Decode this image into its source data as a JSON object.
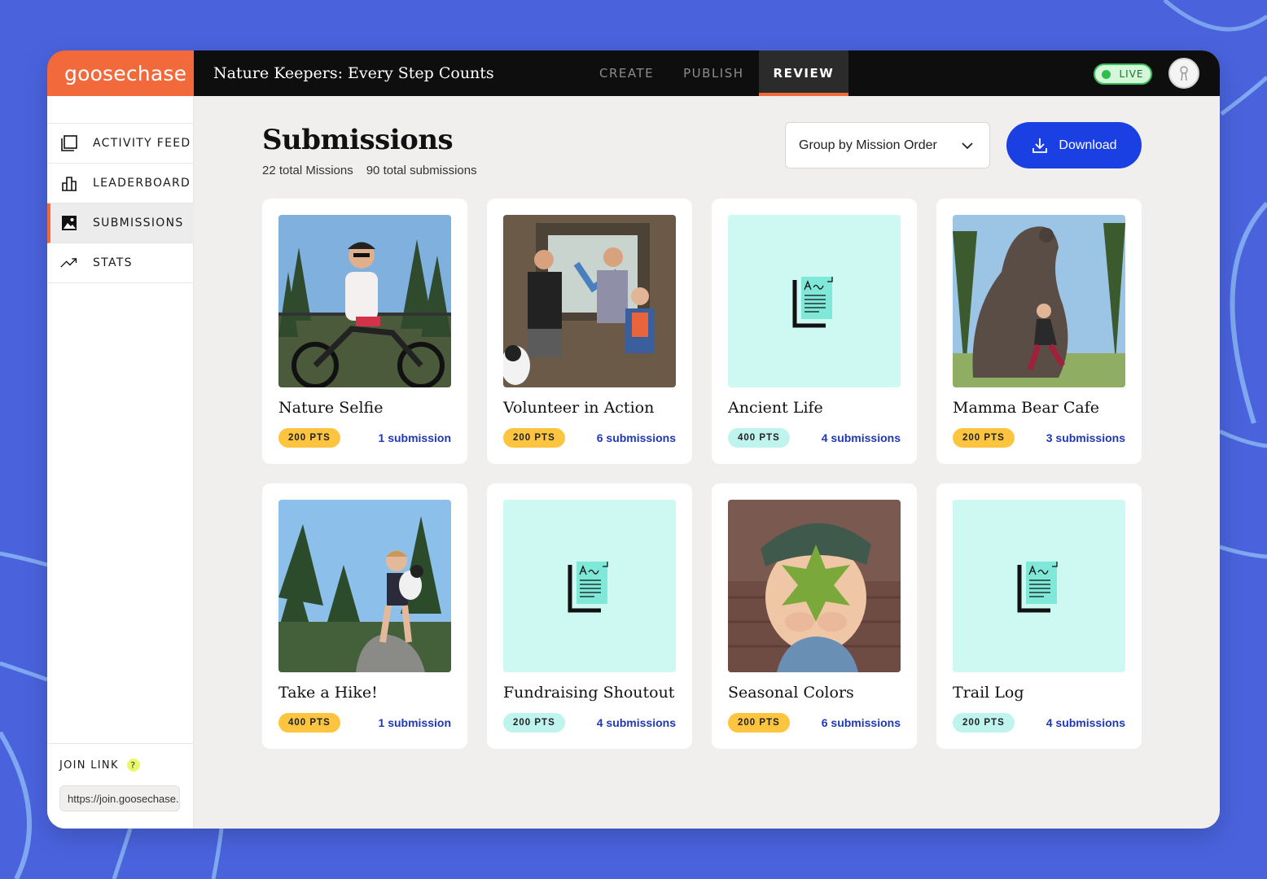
{
  "app": {
    "logo": "goosechase",
    "game_title": "Nature Keepers: Every Step Counts",
    "nav_tabs": [
      {
        "label": "CREATE"
      },
      {
        "label": "PUBLISH"
      },
      {
        "label": "REVIEW",
        "active": true
      }
    ],
    "live_label": "LIVE"
  },
  "sidebar": {
    "items": [
      {
        "label": "ACTIVITY FEED",
        "icon": "activity-feed-icon"
      },
      {
        "label": "LEADERBOARD",
        "icon": "leaderboard-icon"
      },
      {
        "label": "SUBMISSIONS",
        "icon": "image-icon",
        "active": true
      },
      {
        "label": "STATS",
        "icon": "trend-icon"
      }
    ],
    "join_label": "JOIN LINK",
    "help_glyph": "?",
    "join_url": "https://join.goosechase.ai"
  },
  "main": {
    "title": "Submissions",
    "total_missions": "22 total Missions",
    "total_submissions": "90 total submissions",
    "group_by": "Group by Mission Order",
    "download_label": "Download"
  },
  "missions": [
    {
      "title": "Nature Selfie",
      "points": "200 PTS",
      "submissions": "1 submission",
      "thumb": "photo",
      "pts_color": "yellow"
    },
    {
      "title": "Volunteer in Action",
      "points": "200 PTS",
      "submissions": "6 submissions",
      "thumb": "photo",
      "pts_color": "yellow"
    },
    {
      "title": "Ancient Life",
      "points": "400 PTS",
      "submissions": "4 submissions",
      "thumb": "text-doc",
      "pts_color": "teal"
    },
    {
      "title": "Mamma Bear Cafe",
      "points": "200 PTS",
      "submissions": "3 submissions",
      "thumb": "photo",
      "pts_color": "yellow"
    },
    {
      "title": "Take a Hike!",
      "points": "400 PTS",
      "submissions": "1 submission",
      "thumb": "photo",
      "pts_color": "yellow"
    },
    {
      "title": "Fundraising Shoutout",
      "points": "200 PTS",
      "submissions": "4 submissions",
      "thumb": "text-doc",
      "pts_color": "teal"
    },
    {
      "title": "Seasonal Colors",
      "points": "200 PTS",
      "submissions": "6 submissions",
      "thumb": "photo",
      "pts_color": "yellow"
    },
    {
      "title": "Trail Log",
      "points": "200 PTS",
      "submissions": "4 submissions",
      "thumb": "text-doc",
      "pts_color": "teal"
    }
  ],
  "colors": {
    "brand_orange": "#f26a3c",
    "primary_blue": "#1a3fe3",
    "background": "#4a63dd",
    "points_yellow": "#fdc53f",
    "points_teal": "#bff4ee"
  }
}
